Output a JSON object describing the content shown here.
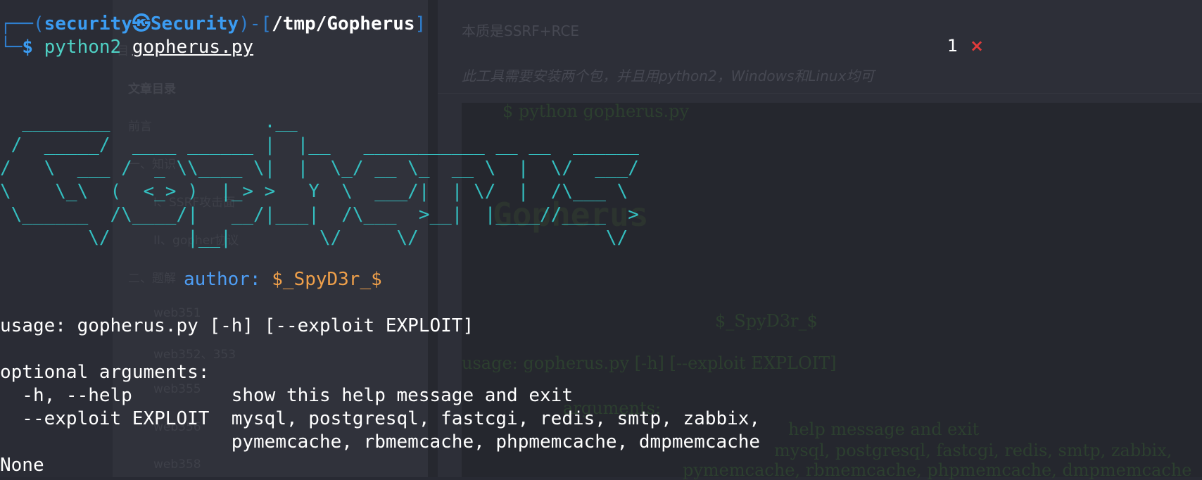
{
  "prompt": {
    "box_top": "┌──(",
    "user_host": "security㉿Security",
    "box_mid": ")-[",
    "path": "/tmp/Gopherus",
    "box_end": "]",
    "box_bottom": "└─",
    "dollar": "$",
    "command": "python2",
    "script_file": "gopherus.py"
  },
  "banner": {
    "ascii_art": "  ________              .__\n /  _____/  ____ ______ |  |__   ___________ __ __  ______\n/   \\  ___ /  _ \\\\____ \\|  |  \\_/ __ \\_  __ \\  |  \\/  ___/\n\\    \\_\\  (  <_> )  |_> >   Y  \\  ___/|  | \\/  |  /\\___ \\\n \\______  /\\____/|   __/|___|  /\\___  >__|  |____//____  >\n        \\/       |__|        \\/     \\/                 \\/",
    "author_label": "author:",
    "author_name": "$_SpyD3r_$"
  },
  "help": {
    "usage": "usage: gopherus.py [-h] [--exploit EXPLOIT]",
    "optional_header": "optional arguments:",
    "opt_help": "  -h, --help         show this help message and exit",
    "opt_exploit": "  --exploit EXPLOIT  mysql, postgresql, fastcgi, redis, smtp, zabbix,",
    "opt_exploit_cont": "                     pymemcache, rbmemcache, phpmemcache, dmpmemcache",
    "result": "None"
  },
  "notification": {
    "count": "1",
    "close_symbol": "×"
  },
  "background_page": {
    "toc_items": [
      "目",
      "文章目录",
      "前言",
      "一、知识",
      "I、SSRF攻击面",
      "II、gopher协议",
      "二、题解",
      "web351",
      "web352、353",
      "web355",
      "web356",
      "web358"
    ],
    "article_line1": "本质是SSRF+RCE",
    "article_line2": "此工具需要安装两个包，并且用python2，Windows和Linux均可",
    "code_cmd": "$ python gopherus.py",
    "code_banner": "Gopherus",
    "code_author": "$_SpyD3r_$",
    "code_usage": "usage: gopherus.py [-h] [--exploit EXPLOIT]",
    "code_opt": "arguments:",
    "code_help": "help message and exit",
    "code_exploit": "mysql, postgresql, fastcgi, redis, smtp, zabbix,",
    "code_exploit2": "pymemcache, rbmemcache, phpmemcache, dmpmemcache"
  },
  "colors": {
    "terminal_bg": "#282a33",
    "prompt_blue": "#3b9cf2",
    "command_cyan": "#4fd1c5",
    "banner_teal": "#34bfc0",
    "author_orange": "#f0a04a",
    "close_red": "#e33b3b"
  }
}
